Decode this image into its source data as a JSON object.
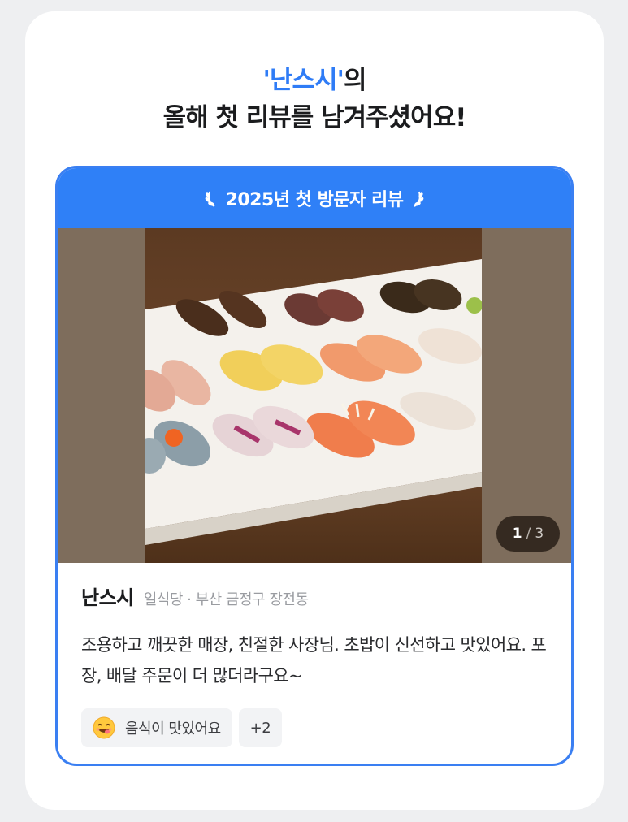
{
  "headline": {
    "highlight": "'난스시'",
    "suffix": "의",
    "line2": "올해 첫 리뷰를 남겨주셨어요!"
  },
  "card": {
    "header_label": "2025년 첫 방문자 리뷰",
    "photo_counter": {
      "current": "1",
      "separator": "/",
      "total": "3"
    },
    "place_name": "난스시",
    "place_meta": "일식당 · 부산 금정구 장전동",
    "review_text": "조용하고 깨끗한 매장, 친절한 사장님. 초밥이 신선하고 맛있어요. 포장, 배달 주문이 더 많더라구요~",
    "tags": [
      {
        "label": "음식이 맛있어요",
        "icon": "yum-face-emoji"
      },
      {
        "label": "+2"
      }
    ]
  },
  "colors": {
    "accent": "#2f7cf6",
    "header_bg": "#2f80f7",
    "card_border": "#3a7ff2",
    "page_bg": "#eeeff1"
  }
}
